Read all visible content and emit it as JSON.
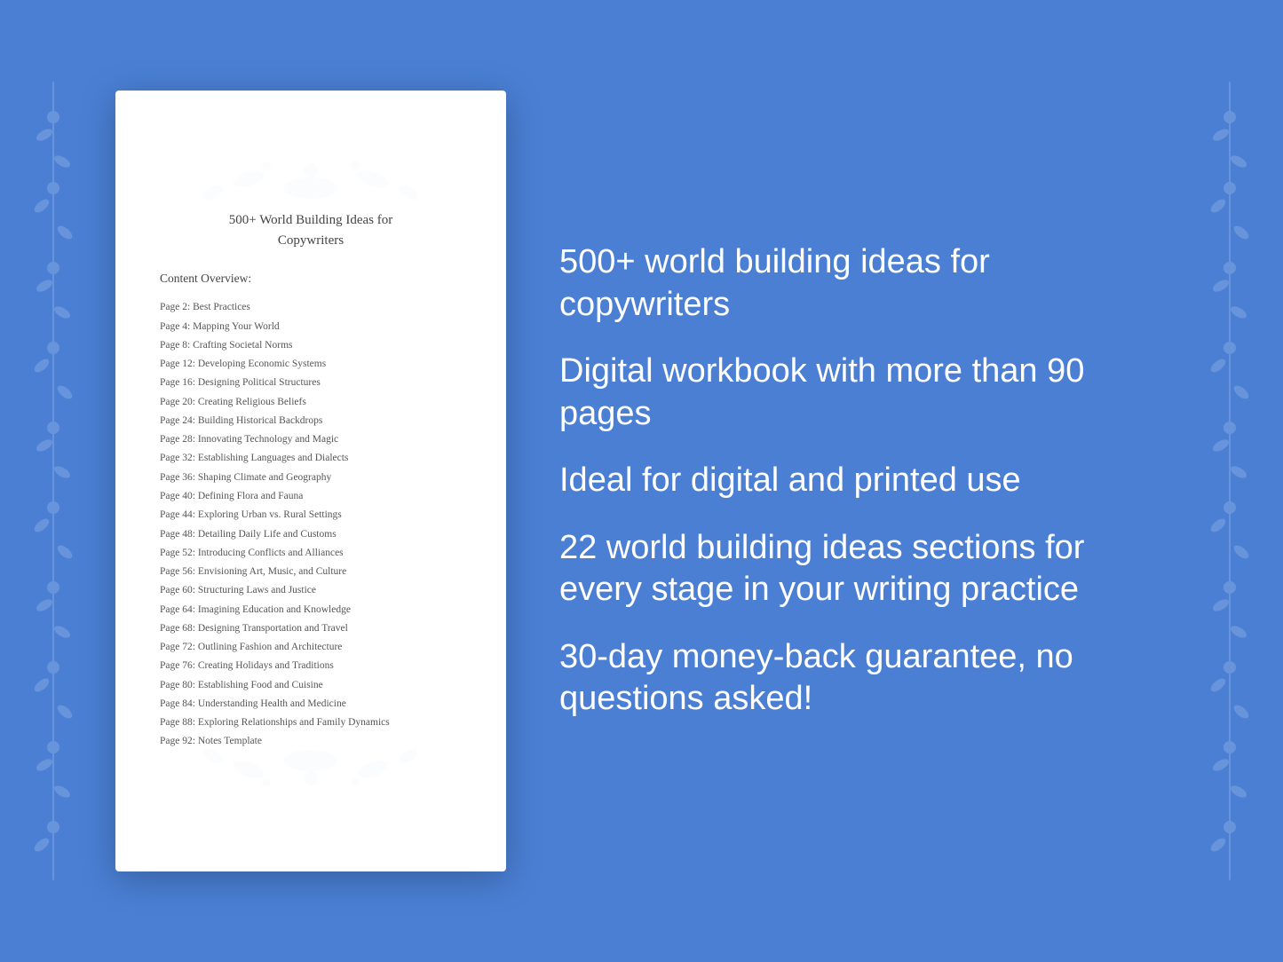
{
  "background": {
    "color": "#4a7fd4"
  },
  "document": {
    "title_line1": "500+ World Building Ideas for",
    "title_line2": "Copywriters",
    "content_overview": "Content Overview:",
    "toc_items": [
      {
        "page": "Page  2:",
        "label": "Best Practices"
      },
      {
        "page": "Page  4:",
        "label": "Mapping Your World"
      },
      {
        "page": "Page  8:",
        "label": "Crafting Societal Norms"
      },
      {
        "page": "Page 12:",
        "label": "Developing Economic Systems"
      },
      {
        "page": "Page 16:",
        "label": "Designing Political Structures"
      },
      {
        "page": "Page 20:",
        "label": "Creating Religious Beliefs"
      },
      {
        "page": "Page 24:",
        "label": "Building Historical Backdrops"
      },
      {
        "page": "Page 28:",
        "label": "Innovating Technology and Magic"
      },
      {
        "page": "Page 32:",
        "label": "Establishing Languages and Dialects"
      },
      {
        "page": "Page 36:",
        "label": "Shaping Climate and Geography"
      },
      {
        "page": "Page 40:",
        "label": "Defining Flora and Fauna"
      },
      {
        "page": "Page 44:",
        "label": "Exploring Urban vs. Rural Settings"
      },
      {
        "page": "Page 48:",
        "label": "Detailing Daily Life and Customs"
      },
      {
        "page": "Page 52:",
        "label": "Introducing Conflicts and Alliances"
      },
      {
        "page": "Page 56:",
        "label": "Envisioning Art, Music, and Culture"
      },
      {
        "page": "Page 60:",
        "label": "Structuring Laws and Justice"
      },
      {
        "page": "Page 64:",
        "label": "Imagining Education and Knowledge"
      },
      {
        "page": "Page 68:",
        "label": "Designing Transportation and Travel"
      },
      {
        "page": "Page 72:",
        "label": "Outlining Fashion and Architecture"
      },
      {
        "page": "Page 76:",
        "label": "Creating Holidays and Traditions"
      },
      {
        "page": "Page 80:",
        "label": "Establishing Food and Cuisine"
      },
      {
        "page": "Page 84:",
        "label": "Understanding Health and Medicine"
      },
      {
        "page": "Page 88:",
        "label": "Exploring Relationships and Family Dynamics"
      },
      {
        "page": "Page 92:",
        "label": "Notes Template"
      }
    ]
  },
  "features": [
    {
      "text": "500+ world building ideas for copywriters"
    },
    {
      "text": "Digital workbook with more than 90 pages"
    },
    {
      "text": "Ideal for digital and printed use"
    },
    {
      "text": "22 world building ideas sections for every stage in your writing practice"
    },
    {
      "text": "30-day money-back guarantee, no questions asked!"
    }
  ]
}
